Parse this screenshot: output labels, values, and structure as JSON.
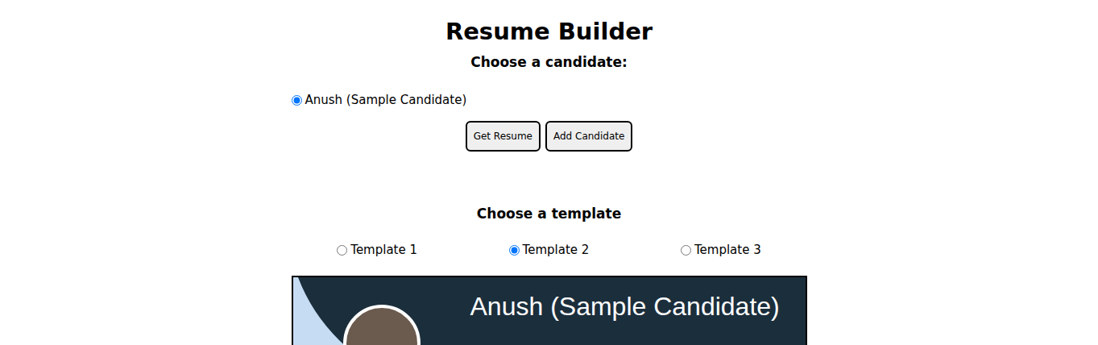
{
  "window": {
    "title": "Resume Builder"
  },
  "candidate_section": {
    "heading": "Choose a candidate:",
    "candidates": [
      {
        "label": "Anush (Sample Candidate)",
        "selected": true
      }
    ]
  },
  "buttons": [
    {
      "label": "Get Resume"
    },
    {
      "label": "Add Candidate"
    }
  ],
  "template_section": {
    "heading": "Choose a template",
    "templates": [
      {
        "label": "Template 1",
        "selected": false
      },
      {
        "label": "Template 2",
        "selected": true
      },
      {
        "label": "Template 3",
        "selected": false
      }
    ]
  },
  "preview": {
    "name": "Anush (Sample Candidate)"
  }
}
